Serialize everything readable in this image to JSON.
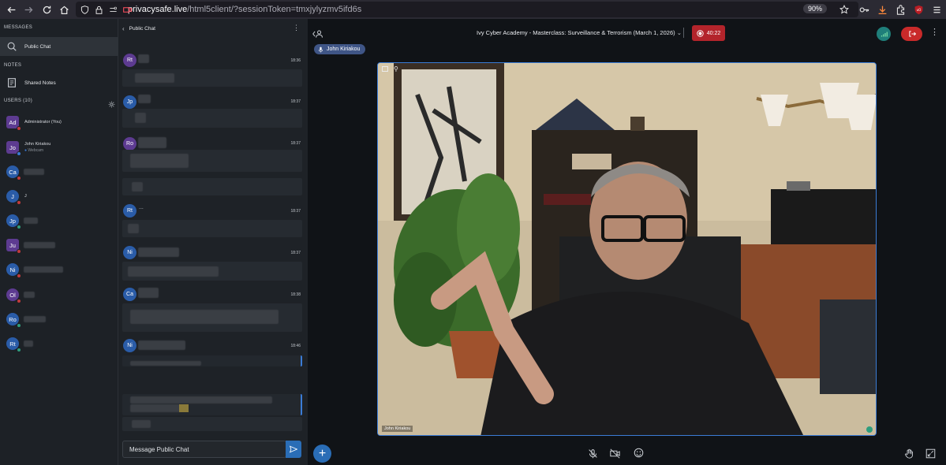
{
  "browser": {
    "url_host": "privacysafe.live",
    "url_path": "/html5client/?sessionToken=tmxjylyzmv5ifd6s",
    "zoom": "90%"
  },
  "sidebar": {
    "messages_label": "MESSAGES",
    "public_chat_label": "Public Chat",
    "notes_label": "NOTES",
    "shared_notes_label": "Shared Notes",
    "users_label": "USERS (10)",
    "users": [
      {
        "initials": "Ad",
        "name": "Administrator (You)",
        "color": "#5d3b91"
      },
      {
        "initials": "Jo",
        "name": "John Kiriakou",
        "sub": "Webcam",
        "color": "#5d3b91"
      },
      {
        "initials": "Ca",
        "name": "",
        "color": "#2a5ca8"
      },
      {
        "initials": "J",
        "name": "J",
        "color": "#2a5ca8"
      },
      {
        "initials": "Jp",
        "name": "",
        "color": "#2a5ca8"
      },
      {
        "initials": "Ju",
        "name": "",
        "color": "#5d3b91"
      },
      {
        "initials": "Ni",
        "name": "",
        "color": "#2a5ca8"
      },
      {
        "initials": "Ol",
        "name": "",
        "color": "#5d3b91"
      },
      {
        "initials": "Ro",
        "name": "",
        "color": "#2a5ca8"
      },
      {
        "initials": "Rt",
        "name": "",
        "color": "#2a5ca8"
      }
    ]
  },
  "chat": {
    "header_title": "Public Chat",
    "input_placeholder": "Message Public Chat",
    "messages": [
      {
        "initials": "Rt",
        "time": "18:36",
        "color": "#5d3b91"
      },
      {
        "initials": "Jp",
        "time": "18:37",
        "color": "#2a5ca8"
      },
      {
        "initials": "Ro",
        "time": "18:37",
        "color": "#5d3b91"
      },
      {
        "initials": "Rt",
        "time": "18:37",
        "color": "#2a5ca8",
        "name": "..."
      },
      {
        "initials": "Ni",
        "time": "18:37",
        "color": "#2a5ca8"
      },
      {
        "initials": "Ca",
        "time": "18:38",
        "color": "#2a5ca8"
      },
      {
        "initials": "Ni",
        "time": "18:46",
        "color": "#2a5ca8"
      }
    ]
  },
  "main": {
    "meeting_title": "Ivy Cyber Academy - Masterclass: Surveillance & Terrorism (March 1, 2026)",
    "timer": "40:22",
    "talking_user": "John Kiriakou",
    "video_label": "John Kiriakou"
  },
  "colors": {
    "accent_blue": "#2a6db6",
    "record_red": "#b3242b",
    "leave_red": "#c92a2a"
  }
}
